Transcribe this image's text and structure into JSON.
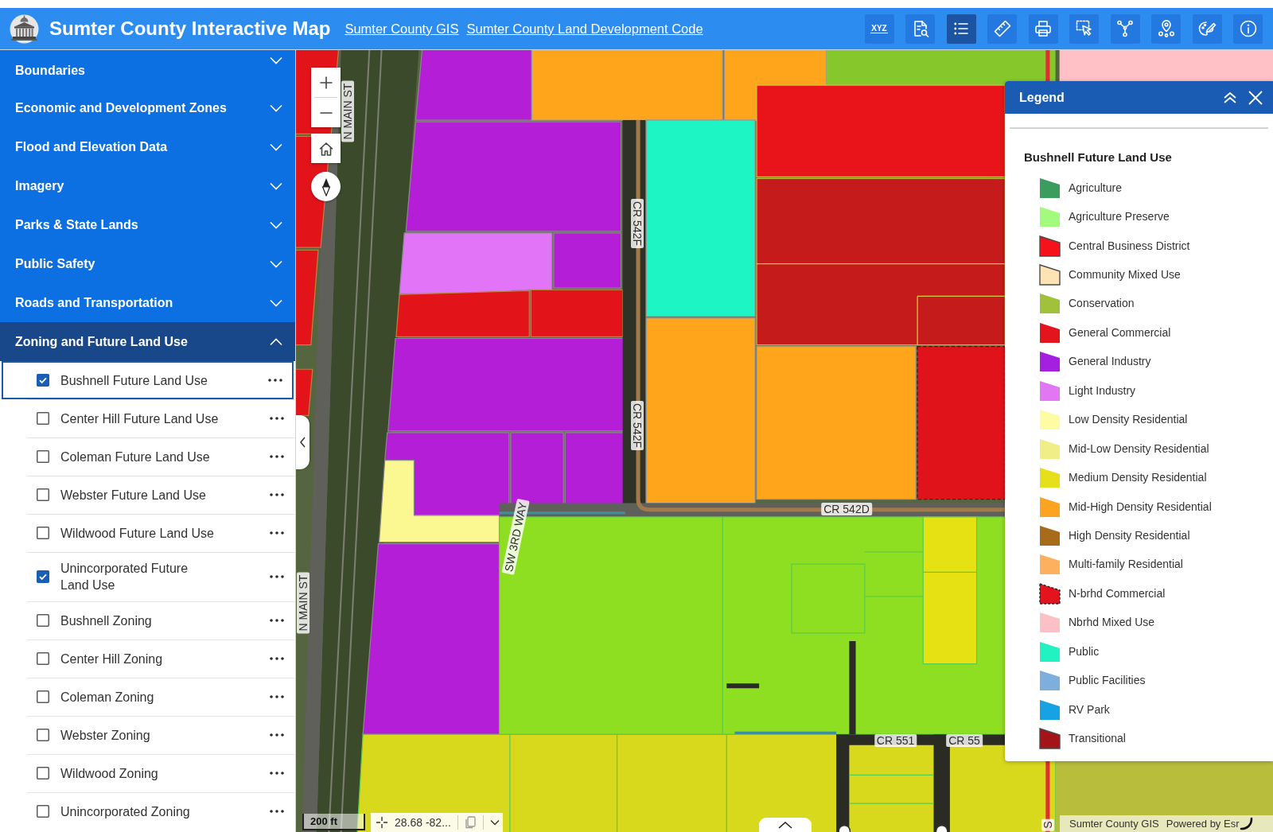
{
  "header": {
    "title": "Sumter County Interactive Map",
    "links": [
      "Sumter County GIS",
      "Sumter County Land Development Code"
    ],
    "tools": [
      {
        "kind": "xyz",
        "label": "XYZ",
        "selected": false
      },
      {
        "kind": "search",
        "selected": false
      },
      {
        "kind": "layers",
        "selected": true
      },
      {
        "kind": "measure",
        "selected": false
      },
      {
        "kind": "print",
        "selected": false
      },
      {
        "kind": "select",
        "selected": false
      },
      {
        "kind": "share",
        "selected": false
      },
      {
        "kind": "locate",
        "selected": false
      },
      {
        "kind": "draw",
        "selected": false
      },
      {
        "kind": "info",
        "selected": false
      }
    ]
  },
  "sidebar": {
    "groups": [
      {
        "title": "Boundaries",
        "expanded": false
      },
      {
        "title": "Economic and Development Zones",
        "expanded": false
      },
      {
        "title": "Flood and Elevation Data",
        "expanded": false
      },
      {
        "title": "Imagery",
        "expanded": false
      },
      {
        "title": "Parks & State Lands",
        "expanded": false
      },
      {
        "title": "Public Safety",
        "expanded": false
      },
      {
        "title": "Roads and Transportation",
        "expanded": false
      },
      {
        "title": "Zoning and Future Land Use",
        "expanded": true,
        "layers": [
          {
            "label": "Bushnell Future Land Use",
            "checked": true,
            "selected": true
          },
          {
            "label": "Center Hill Future Land Use",
            "checked": false,
            "selected": false
          },
          {
            "label": "Coleman Future Land Use",
            "checked": false,
            "selected": false
          },
          {
            "label": "Webster Future Land Use",
            "checked": false,
            "selected": false
          },
          {
            "label": "Wildwood Future Land Use",
            "checked": false,
            "selected": false
          },
          {
            "label": "Unincorporated Future Land Use",
            "checked": true,
            "selected": false
          },
          {
            "label": "Bushnell Zoning",
            "checked": false,
            "selected": false
          },
          {
            "label": "Center Hill Zoning",
            "checked": false,
            "selected": false
          },
          {
            "label": "Coleman Zoning",
            "checked": false,
            "selected": false
          },
          {
            "label": "Webster Zoning",
            "checked": false,
            "selected": false
          },
          {
            "label": "Wildwood Zoning",
            "checked": false,
            "selected": false
          },
          {
            "label": "Unincorporated Zoning",
            "checked": false,
            "selected": false
          }
        ]
      }
    ]
  },
  "map": {
    "labels": [
      "N MAIN ST",
      "N MAIN ST",
      "CR 542F",
      "CR 542F",
      "CR 542D",
      "SW 3RD WAY",
      "CR 551",
      "CR 55",
      "S"
    ],
    "scale": "200 ft",
    "coordinates": "28.68 -82...",
    "attribution": [
      "Sumter County GIS",
      "Powered by Esr"
    ]
  },
  "legend": {
    "title": "Legend",
    "layer_title": "Bushnell Future Land Use",
    "items": [
      {
        "label": "Agriculture",
        "color": "#3a9d5d",
        "kind": "plain"
      },
      {
        "label": "Agriculture Preserve",
        "color": "#a3fb7e",
        "kind": "plain"
      },
      {
        "label": "Central Business District",
        "color": "#f5121a",
        "kind": "outlined"
      },
      {
        "label": "Community Mixed Use",
        "color": "#fde4b2",
        "kind": "outlined"
      },
      {
        "label": "Conservation",
        "color": "#a2c13a",
        "kind": "plain"
      },
      {
        "label": "General Commercial",
        "color": "#e3141e",
        "kind": "plain"
      },
      {
        "label": "General Industry",
        "color": "#a51fe0",
        "kind": "plain"
      },
      {
        "label": "Light Industry",
        "color": "#e277f3",
        "kind": "plain"
      },
      {
        "label": "Low Density Residential",
        "color": "#fdfca4",
        "kind": "plain"
      },
      {
        "label": "Mid-Low Density Residential",
        "color": "#f0ee86",
        "kind": "plain"
      },
      {
        "label": "Medium Density Residential",
        "color": "#e5e01a",
        "kind": "plain"
      },
      {
        "label": "Mid-High Density Residential",
        "color": "#fca322",
        "kind": "plain"
      },
      {
        "label": "High Density Residential",
        "color": "#a86b19",
        "kind": "plain"
      },
      {
        "label": "Multi-family Residential",
        "color": "#fdb15f",
        "kind": "plain"
      },
      {
        "label": "N-brhd Commercial",
        "color": "#e3141e",
        "kind": "dashed"
      },
      {
        "label": "Nbrhd Mixed Use",
        "color": "#fcc1c6",
        "kind": "plain"
      },
      {
        "label": "Public",
        "color": "#22f2c2",
        "kind": "plain"
      },
      {
        "label": "Public Facilities",
        "color": "#7eaedb",
        "kind": "plain"
      },
      {
        "label": "RV Park",
        "color": "#17a3e3",
        "kind": "plain"
      },
      {
        "label": "Transitional",
        "color": "#a4121a",
        "kind": "outlined"
      }
    ]
  }
}
